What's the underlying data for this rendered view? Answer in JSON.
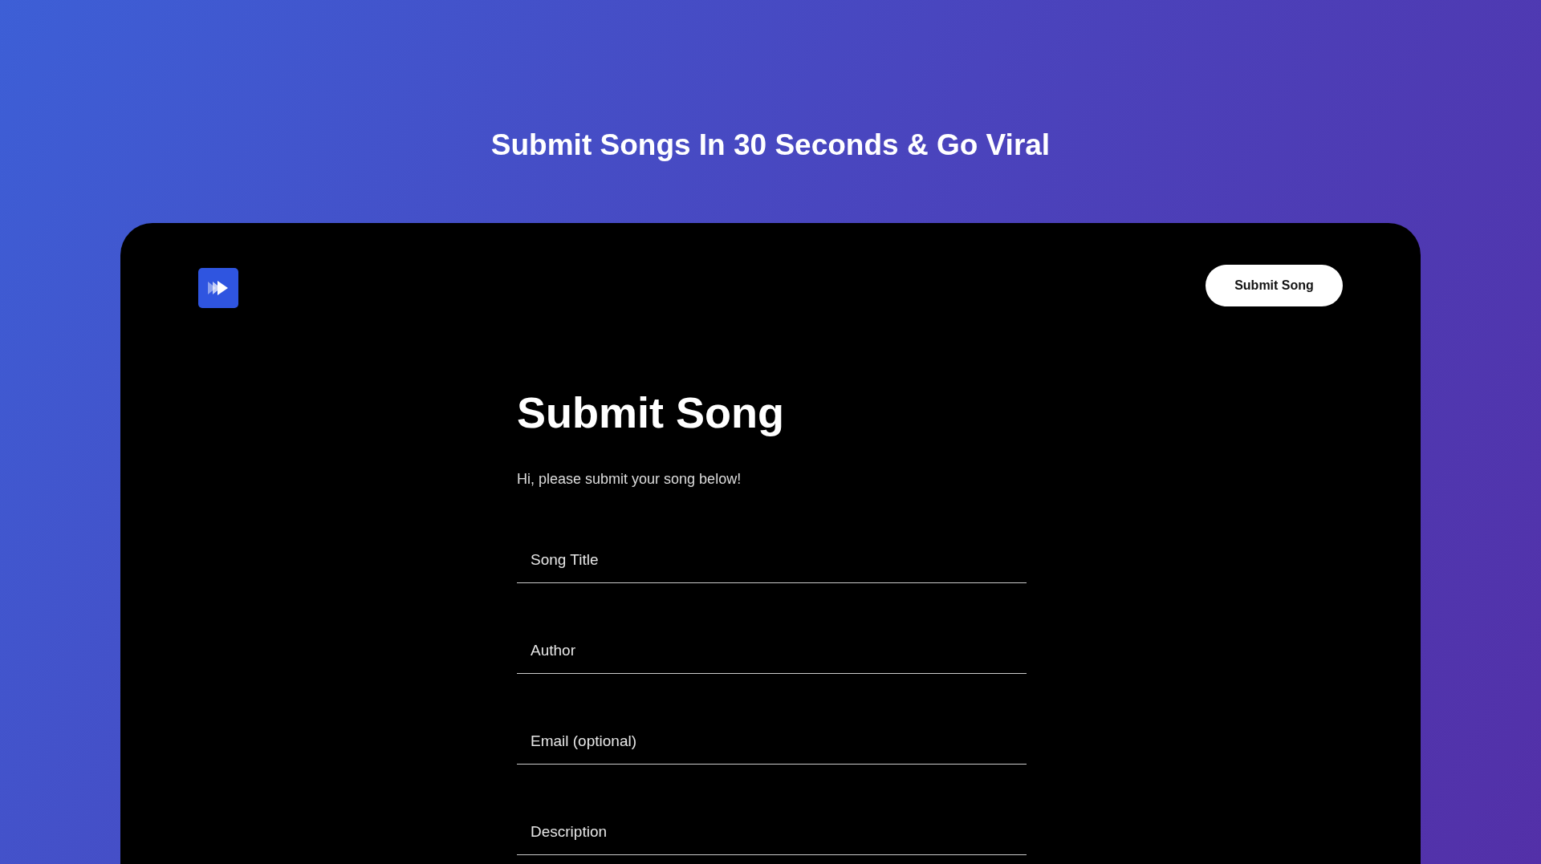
{
  "headline": "Submit Songs In 30 Seconds & Go Viral",
  "header": {
    "button": "Submit Song"
  },
  "form": {
    "title": "Submit Song",
    "subtitle": "Hi, please submit your song below!",
    "fields": [
      {
        "placeholder": "Song Title"
      },
      {
        "placeholder": "Author"
      },
      {
        "placeholder": "Email (optional)"
      },
      {
        "placeholder": "Description"
      }
    ]
  }
}
